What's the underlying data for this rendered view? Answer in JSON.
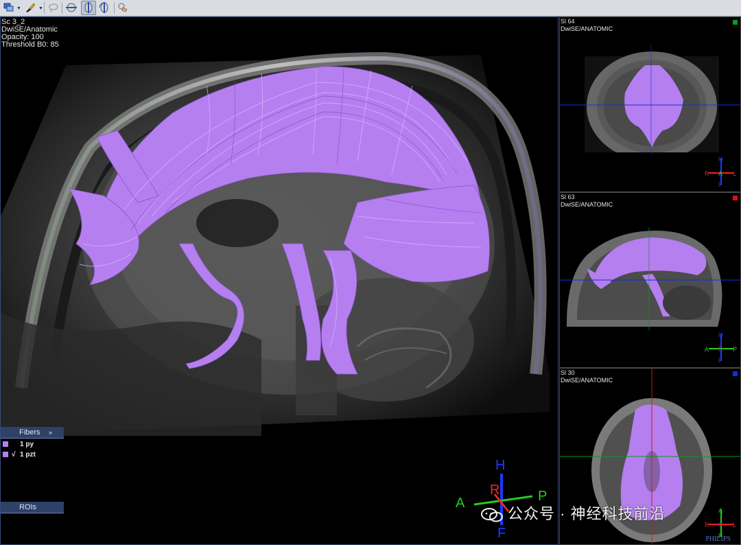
{
  "toolbar": {
    "buttons": [
      {
        "name": "layout-icon"
      },
      {
        "name": "brush-icon"
      },
      {
        "name": "lasso-icon"
      },
      {
        "name": "slice-plane-icon"
      },
      {
        "name": "sagittal-plane-icon"
      },
      {
        "name": "rotate-icon"
      },
      {
        "name": "hand-pointer-icon"
      }
    ]
  },
  "main_view": {
    "lines": [
      "Sc 3_2",
      "DwiSE/Anatomic",
      "Opacity: 100",
      "Threshold B0: 85"
    ],
    "fibers_tab": "Fibers",
    "fibers_tab_chevron": "»",
    "fibers": [
      {
        "check": "",
        "label": "1 py",
        "color": "#b57ff0"
      },
      {
        "check": "√",
        "label": "1 pzt",
        "color": "#b57ff0"
      }
    ],
    "rois_tab": "ROIs",
    "orientation": {
      "top": "H",
      "bottom": "F",
      "left": "A",
      "right": "P",
      "center": "R"
    }
  },
  "side_views": [
    {
      "slice": "Sl 64",
      "series": "DwiSE/ANATOMIC",
      "marker_color": "#0a9a1a",
      "orientation": {
        "top": "H",
        "bottom": "F",
        "left": "R",
        "right": "L",
        "center": "A"
      }
    },
    {
      "slice": "Sl 63",
      "series": "DwiSE/ANATOMIC",
      "marker_color": "#e01010",
      "orientation": {
        "top": "H",
        "bottom": "F",
        "left": "A",
        "right": "P",
        "center": "R"
      }
    },
    {
      "slice": "Sl 30",
      "series": "DwiSE/ANATOMIC",
      "marker_color": "#1030e0",
      "orientation": {
        "top": "A",
        "bottom": "P",
        "left": "R",
        "right": "L",
        "center": "F"
      }
    }
  ],
  "watermark": "公众号 · 神经科技前沿",
  "brand": "PHILIPS",
  "colors": {
    "fiber": "#b57ff0",
    "accent_blue": "#2e4168",
    "axis_h": "#1a3cff",
    "axis_a": "#20d020",
    "axis_r": "#ff2020"
  }
}
